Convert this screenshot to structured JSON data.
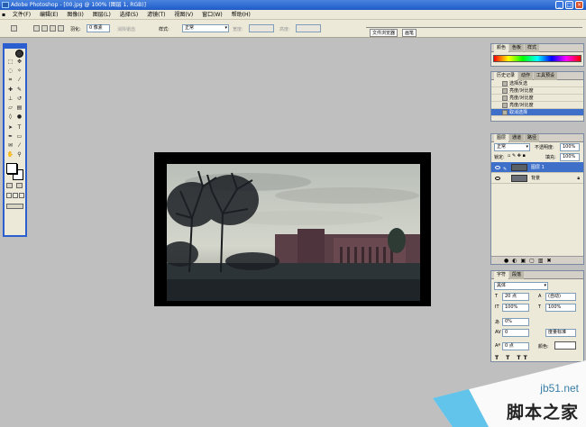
{
  "window": {
    "title": "Adobe Photoshop - [00.jpg @ 100% (图层 1, RGB)]",
    "buttons": [
      "_",
      "□",
      "×"
    ]
  },
  "menu": [
    "文件(F)",
    "编辑(E)",
    "图像(I)",
    "图层(L)",
    "选择(S)",
    "滤镜(T)",
    "视图(V)",
    "窗口(W)",
    "帮助(H)"
  ],
  "options": {
    "feather_label": "羽化:",
    "feather_value": "0 像素",
    "antialias_label": "消除锯齿",
    "style_label": "样式:",
    "style_value": "正常",
    "width_label": "宽度:",
    "height_label": "高度:"
  },
  "palette_well": [
    "文件浏览器",
    "画笔"
  ],
  "color_panel": {
    "tabs": [
      "颜色",
      "色板",
      "样式"
    ]
  },
  "history_panel": {
    "tabs": [
      "历史记录",
      "动作",
      "工具预设"
    ],
    "items": [
      {
        "label": "选择反选",
        "selected": false
      },
      {
        "label": "亮度/对比度",
        "selected": false
      },
      {
        "label": "亮度/对比度",
        "selected": false
      },
      {
        "label": "亮度/对比度",
        "selected": false
      },
      {
        "label": "取消选择",
        "selected": true
      }
    ]
  },
  "layers_panel": {
    "tabs": [
      "图层",
      "通道",
      "路径"
    ],
    "blend_mode": "正常",
    "opacity_label": "不透明度:",
    "opacity_value": "100%",
    "lock_label": "锁定:",
    "fill_label": "填充:",
    "fill_value": "100%",
    "layers": [
      {
        "name": "图层 1",
        "selected": true
      },
      {
        "name": "背景",
        "selected": false
      }
    ]
  },
  "character_panel": {
    "tabs": [
      "字符",
      "段落"
    ],
    "font": "黑体",
    "size": "20 点",
    "leading": "(自动)",
    "vscale": "100%",
    "hscale": "100%",
    "tracking_pct": "0%",
    "tracking": "0",
    "kerning": "度量标准",
    "baseline": "0 点",
    "color_label": "颜色:"
  },
  "watermark": {
    "domain": "jb51.net",
    "cn": "脚本之家"
  },
  "colors": {
    "title_bar": "#1e5bc8",
    "workspace": "#bfbfbf",
    "selection": "#3e6fc9"
  }
}
